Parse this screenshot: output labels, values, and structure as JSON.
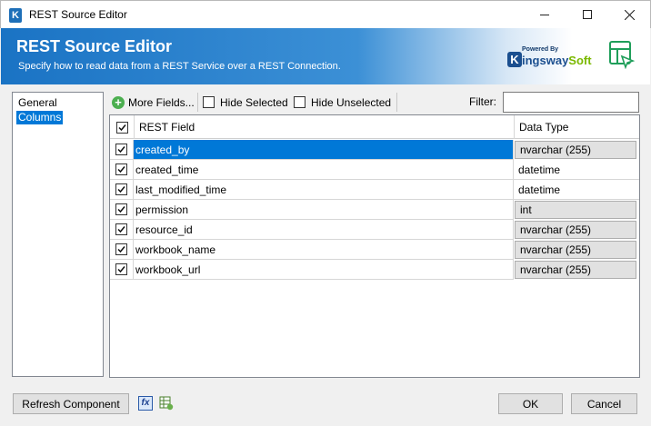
{
  "window": {
    "title": "REST Source Editor",
    "app_icon_letter": "K"
  },
  "banner": {
    "title": "REST Source Editor",
    "subtitle": "Specify how to read data from a REST Service over a REST Connection.",
    "logo_powered_by": "Powered By",
    "logo_brand_main": "ingsway",
    "logo_brand_accent": "Soft",
    "logo_letter": "K"
  },
  "nav": {
    "items": [
      {
        "label": "General",
        "selected": false
      },
      {
        "label": "Columns",
        "selected": true
      }
    ]
  },
  "toolbar": {
    "more_fields_label": "More Fields...",
    "hide_selected_label": "Hide Selected",
    "hide_unselected_label": "Hide Unselected",
    "filter_label": "Filter:",
    "filter_value": ""
  },
  "grid": {
    "headers": {
      "field": "REST Field",
      "type": "Data Type"
    },
    "header_checked": true,
    "rows": [
      {
        "field": "created_by",
        "type": "nvarchar (255)",
        "checked": true,
        "selected": true,
        "boxed": true
      },
      {
        "field": "created_time",
        "type": "datetime",
        "checked": true,
        "selected": false,
        "boxed": false
      },
      {
        "field": "last_modified_time",
        "type": "datetime",
        "checked": true,
        "selected": false,
        "boxed": false
      },
      {
        "field": "permission",
        "type": "int",
        "checked": true,
        "selected": false,
        "boxed": true
      },
      {
        "field": "resource_id",
        "type": "nvarchar (255)",
        "checked": true,
        "selected": false,
        "boxed": true
      },
      {
        "field": "workbook_name",
        "type": "nvarchar (255)",
        "checked": true,
        "selected": false,
        "boxed": true
      },
      {
        "field": "workbook_url",
        "type": "nvarchar (255)",
        "checked": true,
        "selected": false,
        "boxed": true
      }
    ]
  },
  "footer": {
    "refresh_label": "Refresh Component",
    "fx_label": "fx",
    "ok_label": "OK",
    "cancel_label": "Cancel"
  },
  "colors": {
    "selection": "#0078d7",
    "banner_start": "#1a73c4",
    "brand_green": "#7ab800"
  }
}
